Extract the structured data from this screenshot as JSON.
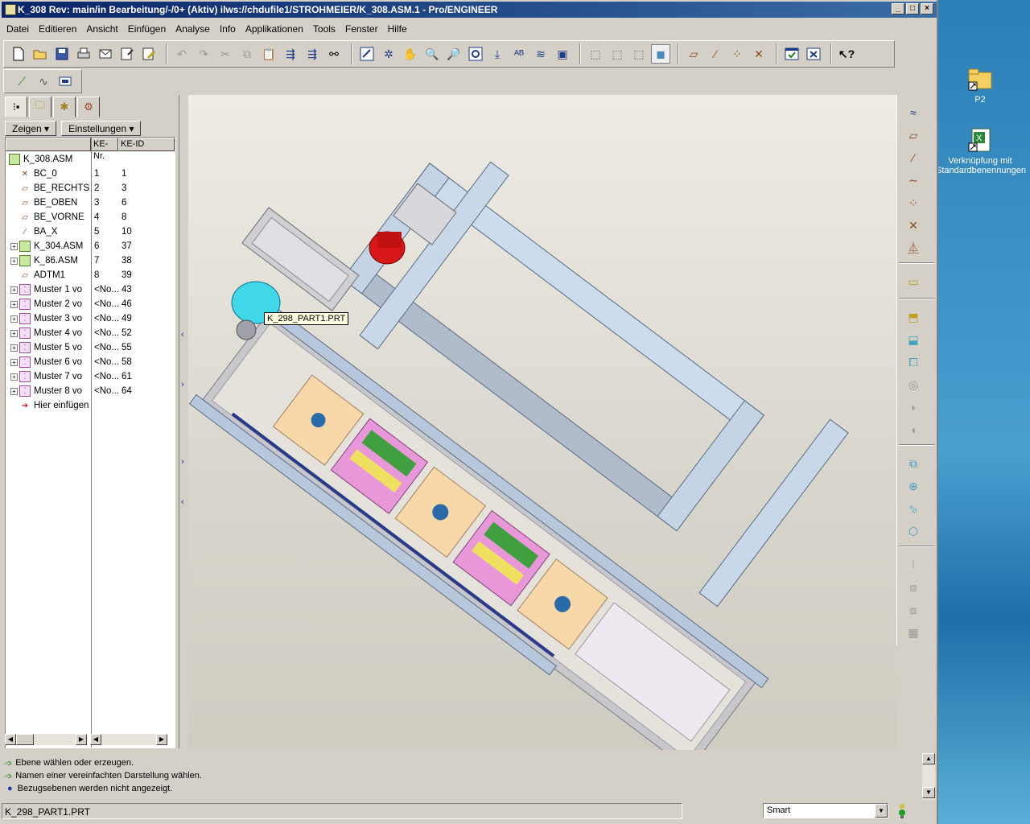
{
  "window": {
    "title": "K_308 Rev: main/in Bearbeitung/-/0+ (Aktiv) ilws://chdufile1/STROHMEIER/K_308.ASM.1 - Pro/ENGINEER",
    "controls": [
      "_",
      "□",
      "×"
    ]
  },
  "menu": [
    "Datei",
    "Editieren",
    "Ansicht",
    "Einfügen",
    "Analyse",
    "Info",
    "Applikationen",
    "Tools",
    "Fenster",
    "Hilfe"
  ],
  "tree": {
    "show_button": "Zeigen ▾",
    "settings_button": "Einstellungen ▾",
    "col_ke_nr": "KE-Nr.",
    "col_ke_id": "KE-ID",
    "root": "K_308.ASM",
    "rows": [
      {
        "label": "BC_0",
        "nr": "1",
        "id": "1",
        "icon": "csys",
        "expand": false
      },
      {
        "label": "BE_RECHTS",
        "nr": "2",
        "id": "3",
        "icon": "plane",
        "expand": false
      },
      {
        "label": "BE_OBEN",
        "nr": "3",
        "id": "6",
        "icon": "plane",
        "expand": false
      },
      {
        "label": "BE_VORNE",
        "nr": "4",
        "id": "8",
        "icon": "plane",
        "expand": false
      },
      {
        "label": "BA_X",
        "nr": "5",
        "id": "10",
        "icon": "axis",
        "expand": false
      },
      {
        "label": "K_304.ASM",
        "nr": "6",
        "id": "37",
        "icon": "asm",
        "expand": true
      },
      {
        "label": "K_86.ASM",
        "nr": "7",
        "id": "38",
        "icon": "asm",
        "expand": true
      },
      {
        "label": "ADTM1",
        "nr": "8",
        "id": "39",
        "icon": "plane",
        "expand": false
      },
      {
        "label": "Muster 1 vo",
        "nr": "<No...",
        "id": "43",
        "icon": "pattern",
        "expand": true
      },
      {
        "label": "Muster 2 vo",
        "nr": "<No...",
        "id": "46",
        "icon": "pattern",
        "expand": true
      },
      {
        "label": "Muster 3 vo",
        "nr": "<No...",
        "id": "49",
        "icon": "pattern",
        "expand": true
      },
      {
        "label": "Muster 4 vo",
        "nr": "<No...",
        "id": "52",
        "icon": "pattern",
        "expand": true
      },
      {
        "label": "Muster 5 vo",
        "nr": "<No...",
        "id": "55",
        "icon": "pattern",
        "expand": true
      },
      {
        "label": "Muster 6 vo",
        "nr": "<No...",
        "id": "58",
        "icon": "pattern",
        "expand": true
      },
      {
        "label": "Muster 7 vo",
        "nr": "<No...",
        "id": "61",
        "icon": "pattern",
        "expand": true
      },
      {
        "label": "Muster 8 vo",
        "nr": "<No...",
        "id": "64",
        "icon": "pattern",
        "expand": true
      },
      {
        "label": "Hier einfügen",
        "nr": "",
        "id": "",
        "icon": "insert",
        "expand": false
      }
    ]
  },
  "viewport": {
    "tooltip": "K_298_PART1.PRT"
  },
  "messages": [
    {
      "text": "Ebene wählen oder erzeugen.",
      "icon": "arrow-icon"
    },
    {
      "text": "Namen einer vereinfachten Darstellung wählen.",
      "icon": "arrow-icon"
    },
    {
      "text": "Bezugsebenen werden nicht angezeigt.",
      "icon": "info-dot-icon"
    }
  ],
  "status": {
    "selection": "K_298_PART1.PRT",
    "filter": "Smart"
  },
  "desktop": [
    {
      "label": "P2",
      "icon": "folder-shortcut-icon"
    },
    {
      "label": "Verknüpfung mit Standardbenennungen",
      "icon": "excel-shortcut-icon"
    }
  ]
}
